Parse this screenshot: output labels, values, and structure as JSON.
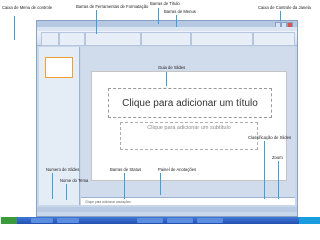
{
  "slide": {
    "title_placeholder": "Clique para adicionar um título",
    "subtitle_placeholder": "Clique para adicionar um subtítulo"
  },
  "notes_placeholder": "Clique para adicionar anotações",
  "annotations": {
    "caixa_menu_controle": "Caixa de Menu de controle",
    "barras_ferramentas": "Barras de Ferramentas de Formatação",
    "barras_titulo": "Barras de Título",
    "barras_menus": "Barras de Menus",
    "caixa_controle_janela": "Caixa de Controle da Janela",
    "guia_slides": "Guia de Slides",
    "classificacao_slides": "Classificação de Slides",
    "zoom": "Zoom",
    "numero_slides": "Numero de Slides",
    "barras_status": "Barras de Status",
    "painel_anotacoes": "Painel de Anotações",
    "nome_tema": "Nome do Tema"
  },
  "colors": {
    "accent": "#3aa0e0",
    "ribbon": "#d3dfee",
    "taskbar": "#2450b0"
  }
}
